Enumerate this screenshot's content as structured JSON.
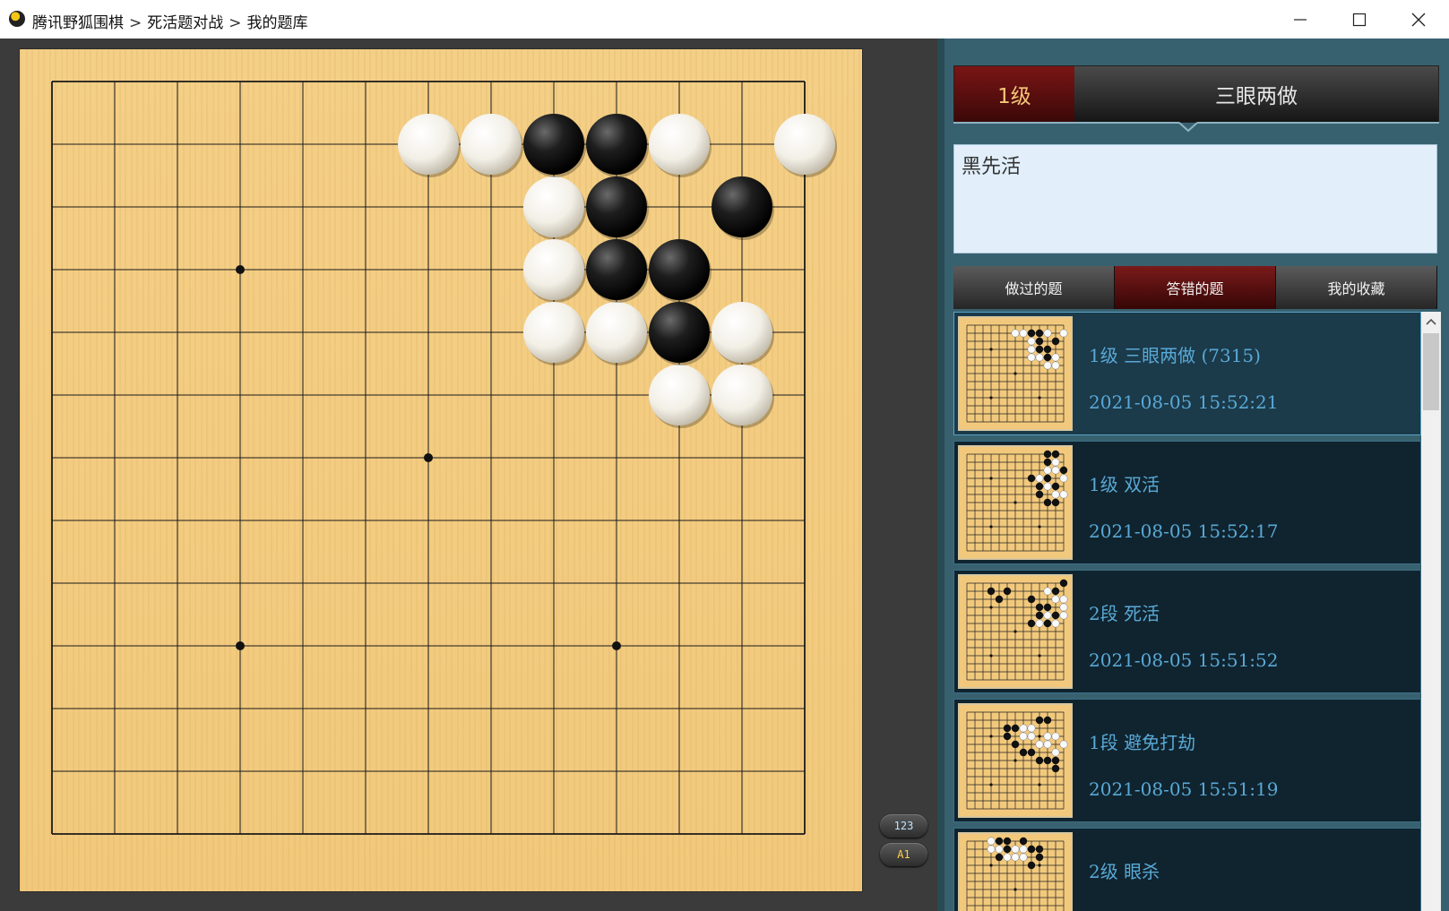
{
  "window": {
    "breadcrumb": [
      "腾讯野狐围棋",
      "死活题对战",
      "我的题库"
    ],
    "separator": ">",
    "controls": {
      "minimize": "—",
      "maximize": "☐",
      "close": "✕"
    }
  },
  "board": {
    "size": 13,
    "star_points": [
      [
        3,
        3
      ],
      [
        9,
        3
      ],
      [
        6,
        6
      ],
      [
        3,
        9
      ],
      [
        9,
        9
      ]
    ],
    "black_stones": [
      [
        8,
        1
      ],
      [
        9,
        1
      ],
      [
        9,
        2
      ],
      [
        11,
        2
      ],
      [
        9,
        3
      ],
      [
        10,
        3
      ],
      [
        10,
        4
      ]
    ],
    "white_stones": [
      [
        6,
        1
      ],
      [
        7,
        1
      ],
      [
        10,
        1
      ],
      [
        12,
        1
      ],
      [
        8,
        2
      ],
      [
        8,
        3
      ],
      [
        8,
        4
      ],
      [
        9,
        4
      ],
      [
        11,
        4
      ],
      [
        10,
        5
      ],
      [
        11,
        5
      ]
    ],
    "toggles": {
      "move_numbers": "123",
      "coordinates": "A1"
    }
  },
  "panel": {
    "level": "1级",
    "title": "三眼两做",
    "hint": "黑先活",
    "tabs": [
      {
        "label": "做过的题",
        "active": false
      },
      {
        "label": "答错的题",
        "active": true
      },
      {
        "label": "我的收藏",
        "active": false
      }
    ],
    "items": [
      {
        "title": "1级  三眼两做 (7315)",
        "date": "2021-08-05  15:52:21",
        "selected": true
      },
      {
        "title": "1级  双活",
        "date": "2021-08-05  15:52:17",
        "selected": false
      },
      {
        "title": "2段  死活",
        "date": "2021-08-05  15:51:52",
        "selected": false
      },
      {
        "title": "1段  避免打劫",
        "date": "2021-08-05  15:51:19",
        "selected": false
      },
      {
        "title": "2级  眼杀",
        "date": "",
        "selected": false
      }
    ]
  },
  "colors": {
    "board": "#f2c97c",
    "panel_bg": "#38616f",
    "item_text": "#59a9d6",
    "active_tab": "#7a1a1a"
  }
}
